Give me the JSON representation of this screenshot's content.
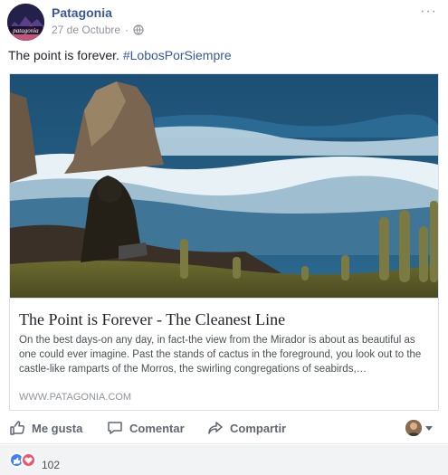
{
  "post": {
    "page_name": "Patagonia",
    "avatar_text": "patagonia",
    "date": "27 de Octubre",
    "dot": "·",
    "more_label": "···",
    "caption_text": "The point is forever. ",
    "hashtag": "#LobosPorSiempre"
  },
  "link_card": {
    "title": "The Point is Forever - The Cleanest Line",
    "description": "On the best days-on any day, in fact-the view from the Mirador is about as beautiful as one could ever imagine. Past the stands of cactus in the foreground, you look out to the castle-like ramparts of the Morros, the swirling congregations of seabirds,…",
    "domain": "WWW.PATAGONIA.COM"
  },
  "actions": {
    "like": "Me gusta",
    "comment": "Comentar",
    "share": "Compartir"
  },
  "reactions": {
    "count": "102"
  },
  "icons": {
    "globe": "globe-icon",
    "like": "thumbs-up-icon",
    "comment": "comment-bubble-icon",
    "share": "share-arrow-icon",
    "caret": "caret-down-icon"
  },
  "colors": {
    "link_blue": "#385898",
    "text_dark": "#1d2129",
    "muted": "#90949c",
    "action_gray": "#616770",
    "reaction_like": "#4080ff",
    "reaction_love": "#f25268"
  }
}
